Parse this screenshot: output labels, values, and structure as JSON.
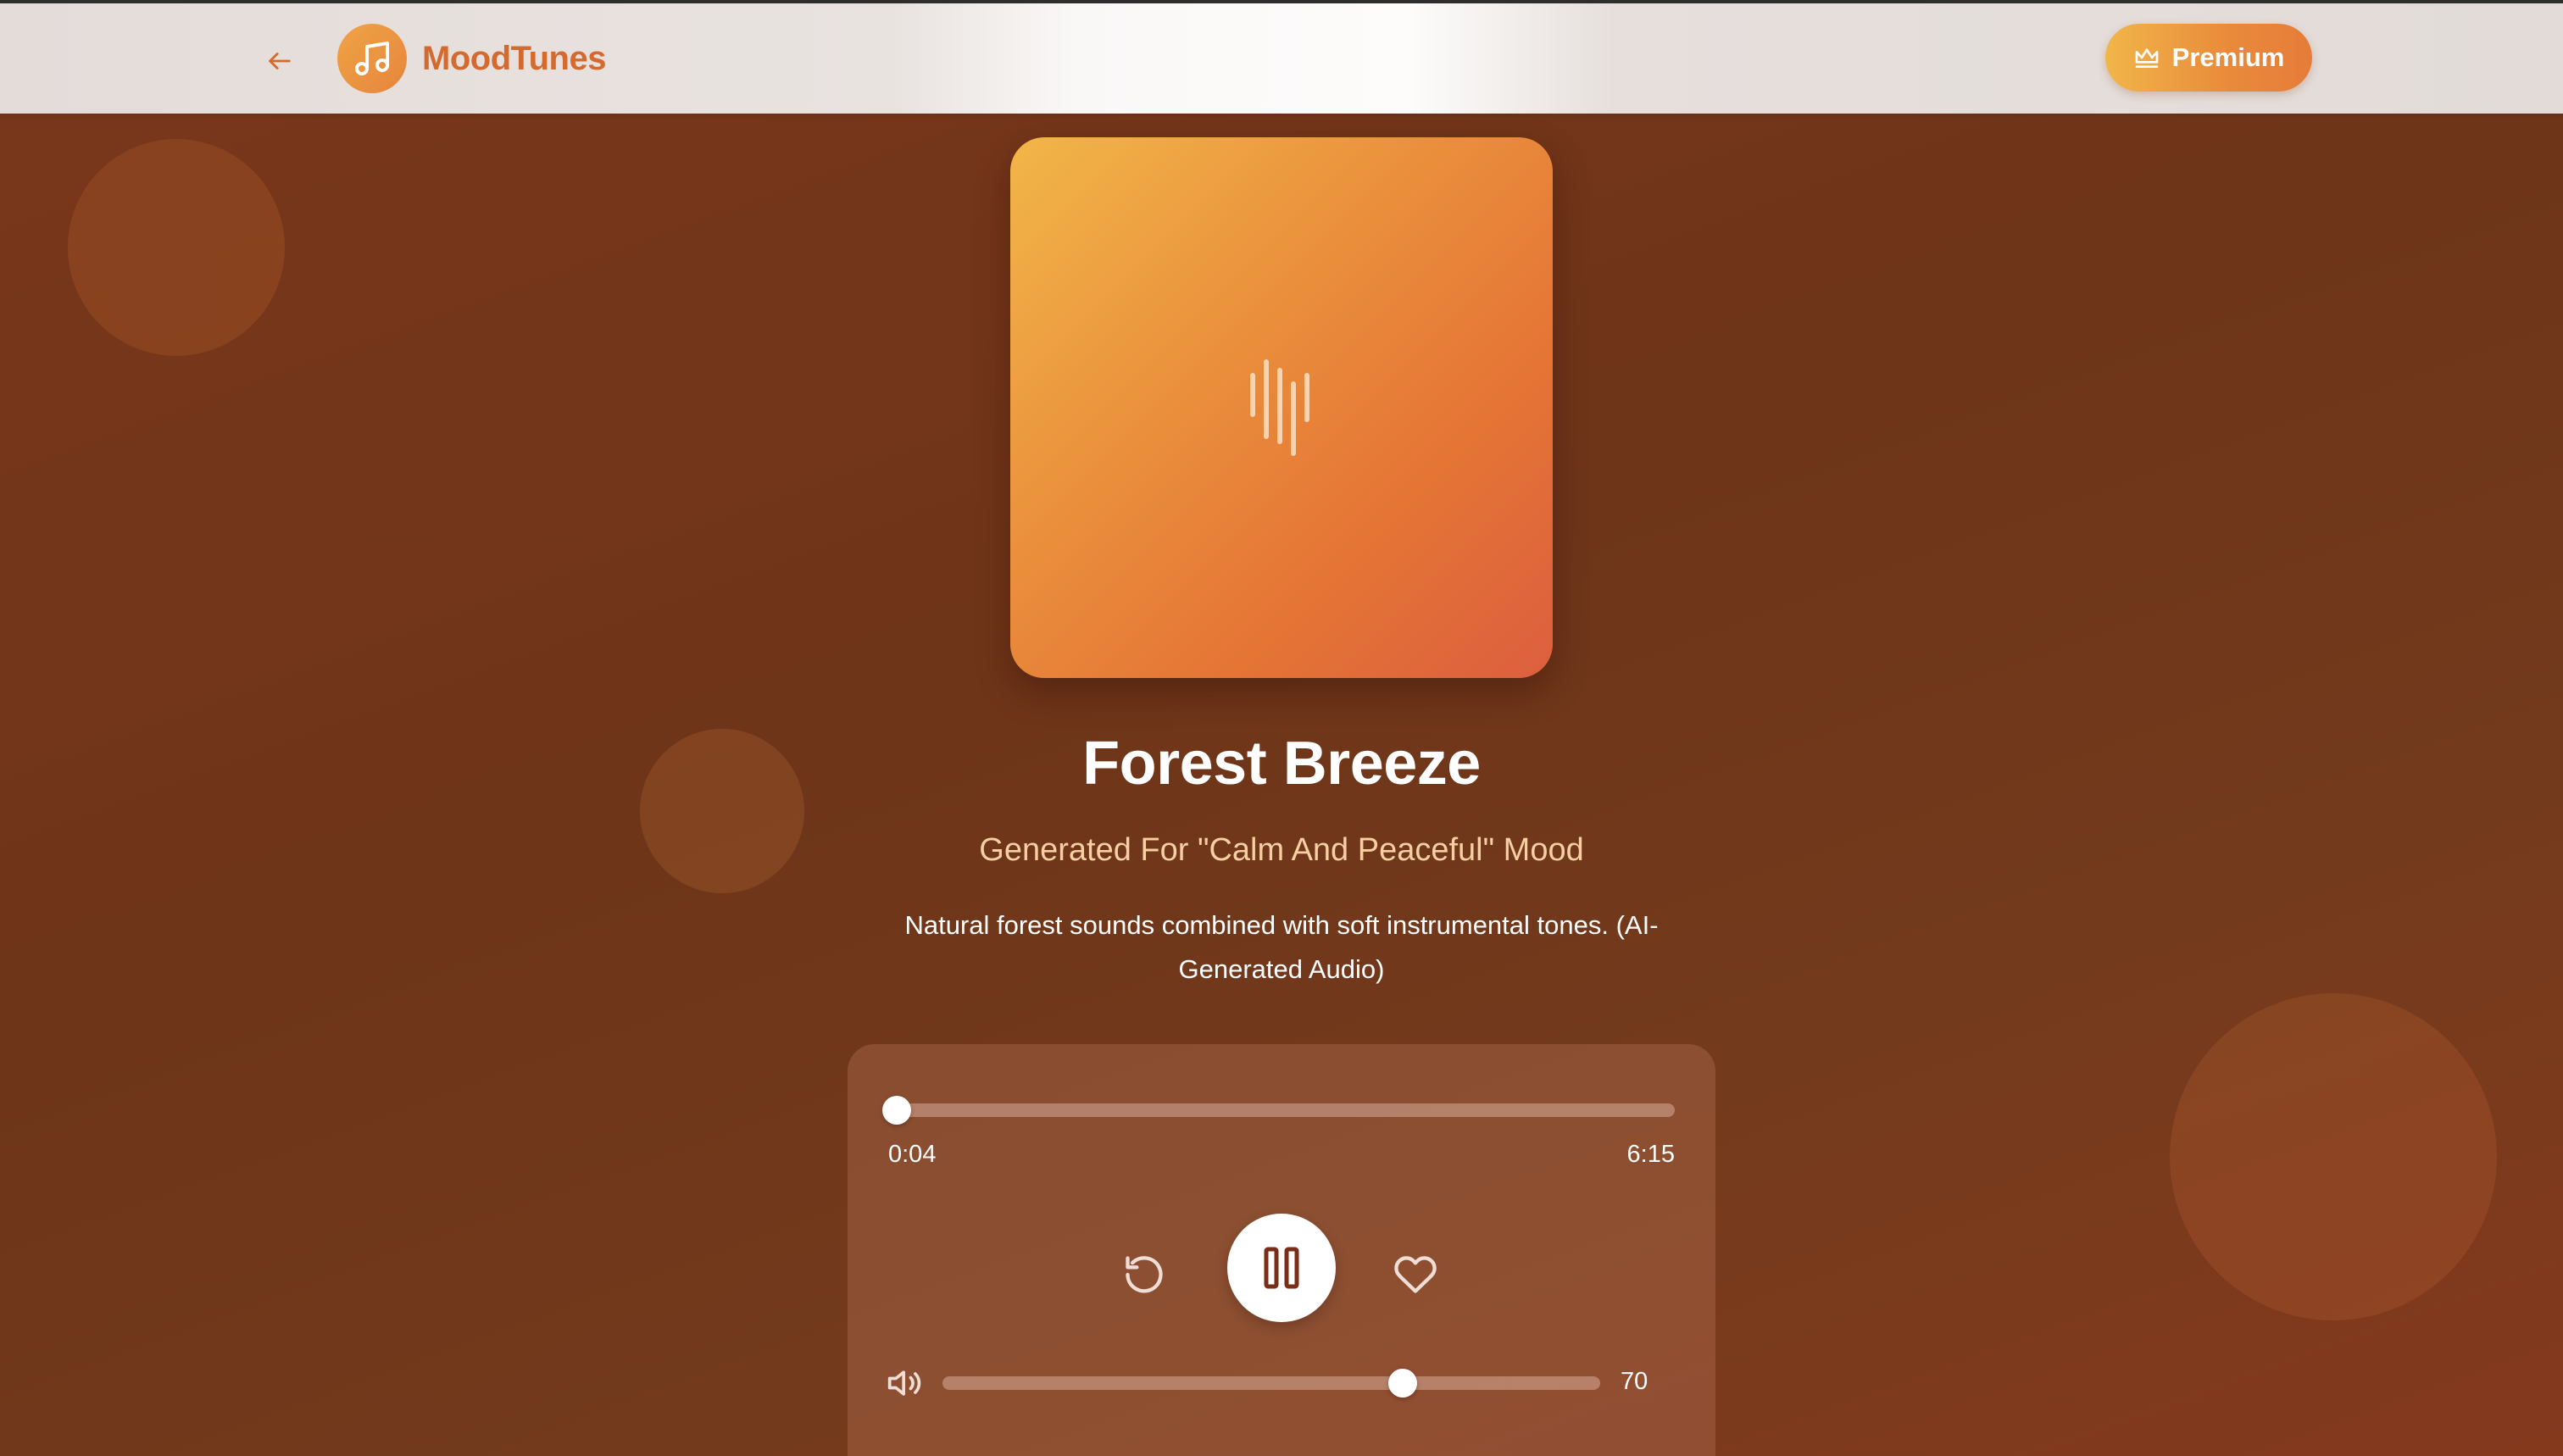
{
  "app": {
    "name": "MoodTunes",
    "premium_label": "Premium"
  },
  "track": {
    "title": "Forest Breeze",
    "subtitle": "Generated For \"Calm And Peaceful\" Mood",
    "description": "Natural forest sounds combined with soft instrumental tones. (AI-Generated Audio)"
  },
  "player": {
    "current_time": "0:04",
    "total_time": "6:15",
    "progress_fraction": 0.011,
    "volume": "70",
    "volume_fraction": 0.7,
    "state": "playing"
  },
  "icons": {
    "back": "arrow-left-icon",
    "logo": "music-note-icon",
    "premium": "crown-icon",
    "album": "soundwave-icon",
    "replay": "replay-icon",
    "pause": "pause-icon",
    "like": "heart-icon",
    "volume": "volume-icon"
  },
  "colors": {
    "accent": "#e98a3b",
    "brand_text": "#d56a2f",
    "background": "#6e3519",
    "subtitle": "#f7cfa3"
  }
}
